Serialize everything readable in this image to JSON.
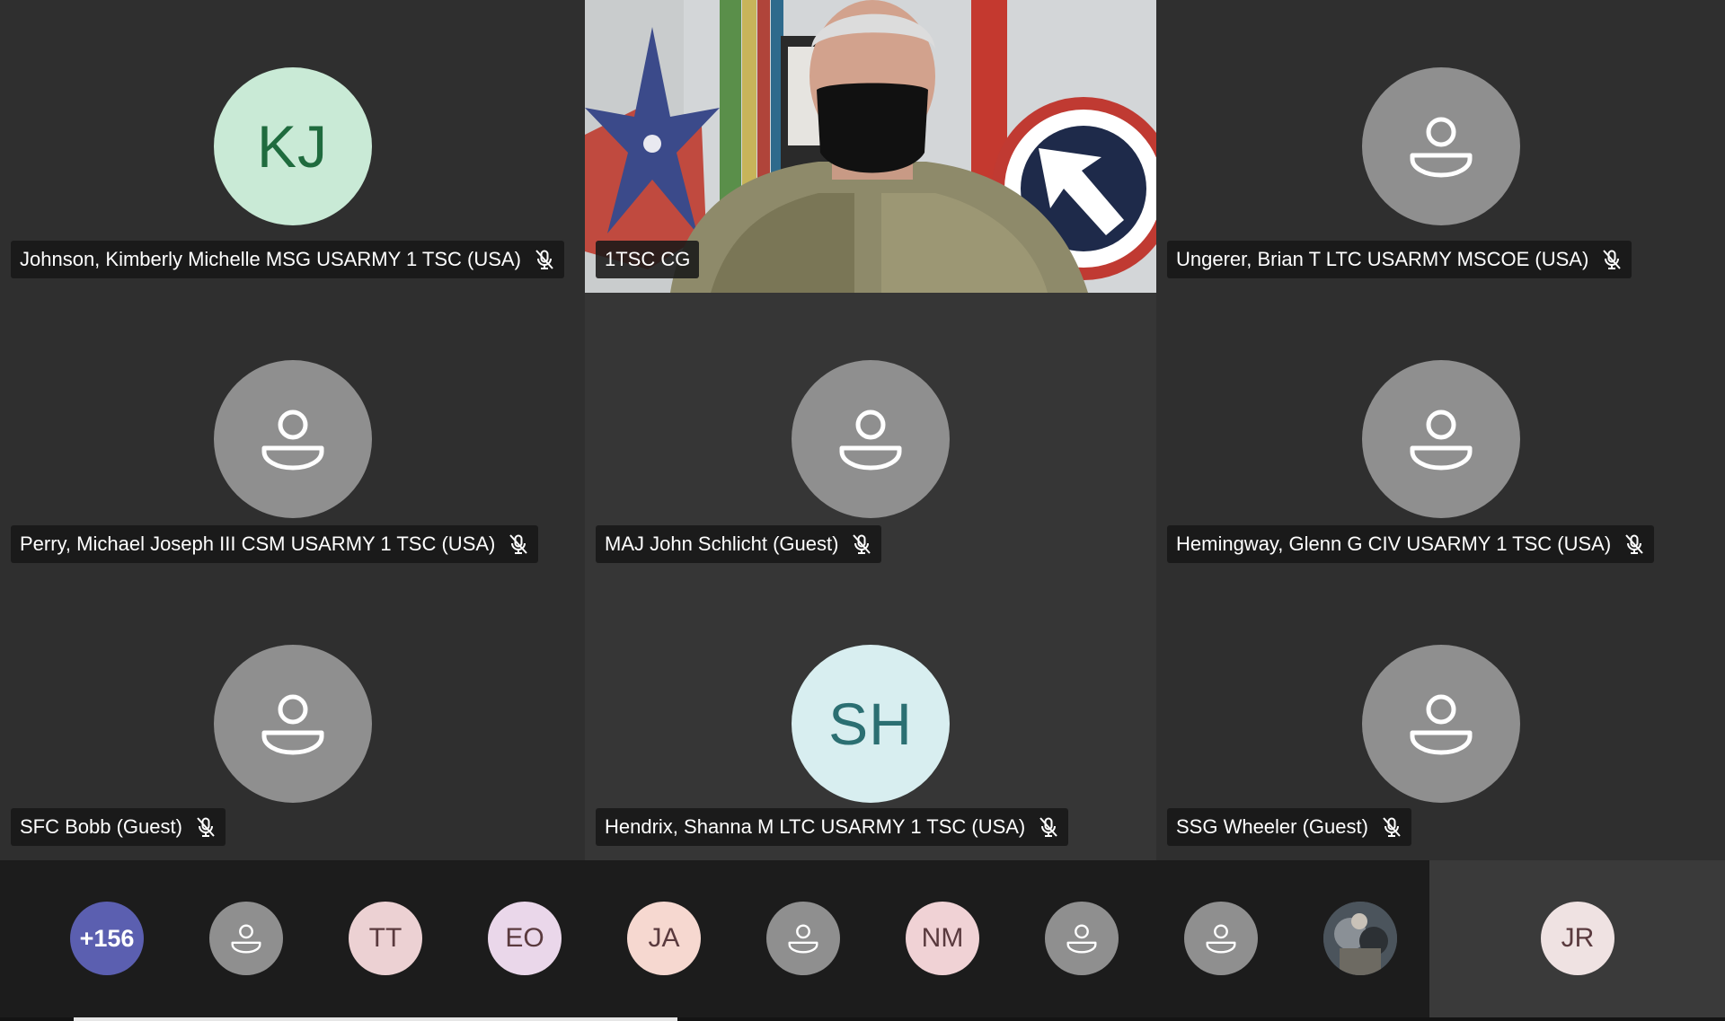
{
  "tiles": [
    {
      "name": "Johnson, Kimberly Michelle MSG USARMY 1 TSC (USA)",
      "initials": "KJ",
      "avatar_bg": "#c9ead6",
      "avatar_fg": "#1f6b3e",
      "muted": true
    },
    {
      "name": "1TSC CG",
      "video": true,
      "muted": false
    },
    {
      "name": "Ungerer, Brian T LTC USARMY MSCOE (USA)",
      "muted": true
    },
    {
      "name": "Perry, Michael Joseph III CSM USARMY 1 TSC (USA)",
      "muted": true
    },
    {
      "name": "MAJ John Schlicht (Guest)",
      "muted": true
    },
    {
      "name": "Hemingway, Glenn G CIV USARMY 1 TSC (USA)",
      "muted": true
    },
    {
      "name": "SFC Bobb (Guest)",
      "muted": true
    },
    {
      "name": "Hendrix, Shanna M LTC USARMY 1 TSC (USA)",
      "initials": "SH",
      "avatar_bg": "#d8eef0",
      "avatar_fg": "#2b6f72",
      "muted": true
    },
    {
      "name": "SSG Wheeler (Guest)",
      "muted": true
    }
  ],
  "strip": {
    "overflow_count": "+156",
    "avatars": [
      {
        "kind": "generic"
      },
      {
        "kind": "initials",
        "text": "TT",
        "bg": "#ecd1d3"
      },
      {
        "kind": "initials",
        "text": "EO",
        "bg": "#ead7ea"
      },
      {
        "kind": "initials",
        "text": "JA",
        "bg": "#f6d8d0"
      },
      {
        "kind": "generic"
      },
      {
        "kind": "initials",
        "text": "NM",
        "bg": "#f0d2d5"
      },
      {
        "kind": "generic"
      },
      {
        "kind": "generic"
      },
      {
        "kind": "photo"
      }
    ],
    "self": {
      "text": "JR",
      "bg": "#efe2e2"
    }
  },
  "progress": 0.35,
  "colors": {
    "muted_icon": "#ffffff",
    "overflow_bg": "#5b5fb0",
    "generic_avatar": "#8f8f8f"
  },
  "icons": {
    "mic": "mic-off-icon",
    "person": "person-icon"
  }
}
